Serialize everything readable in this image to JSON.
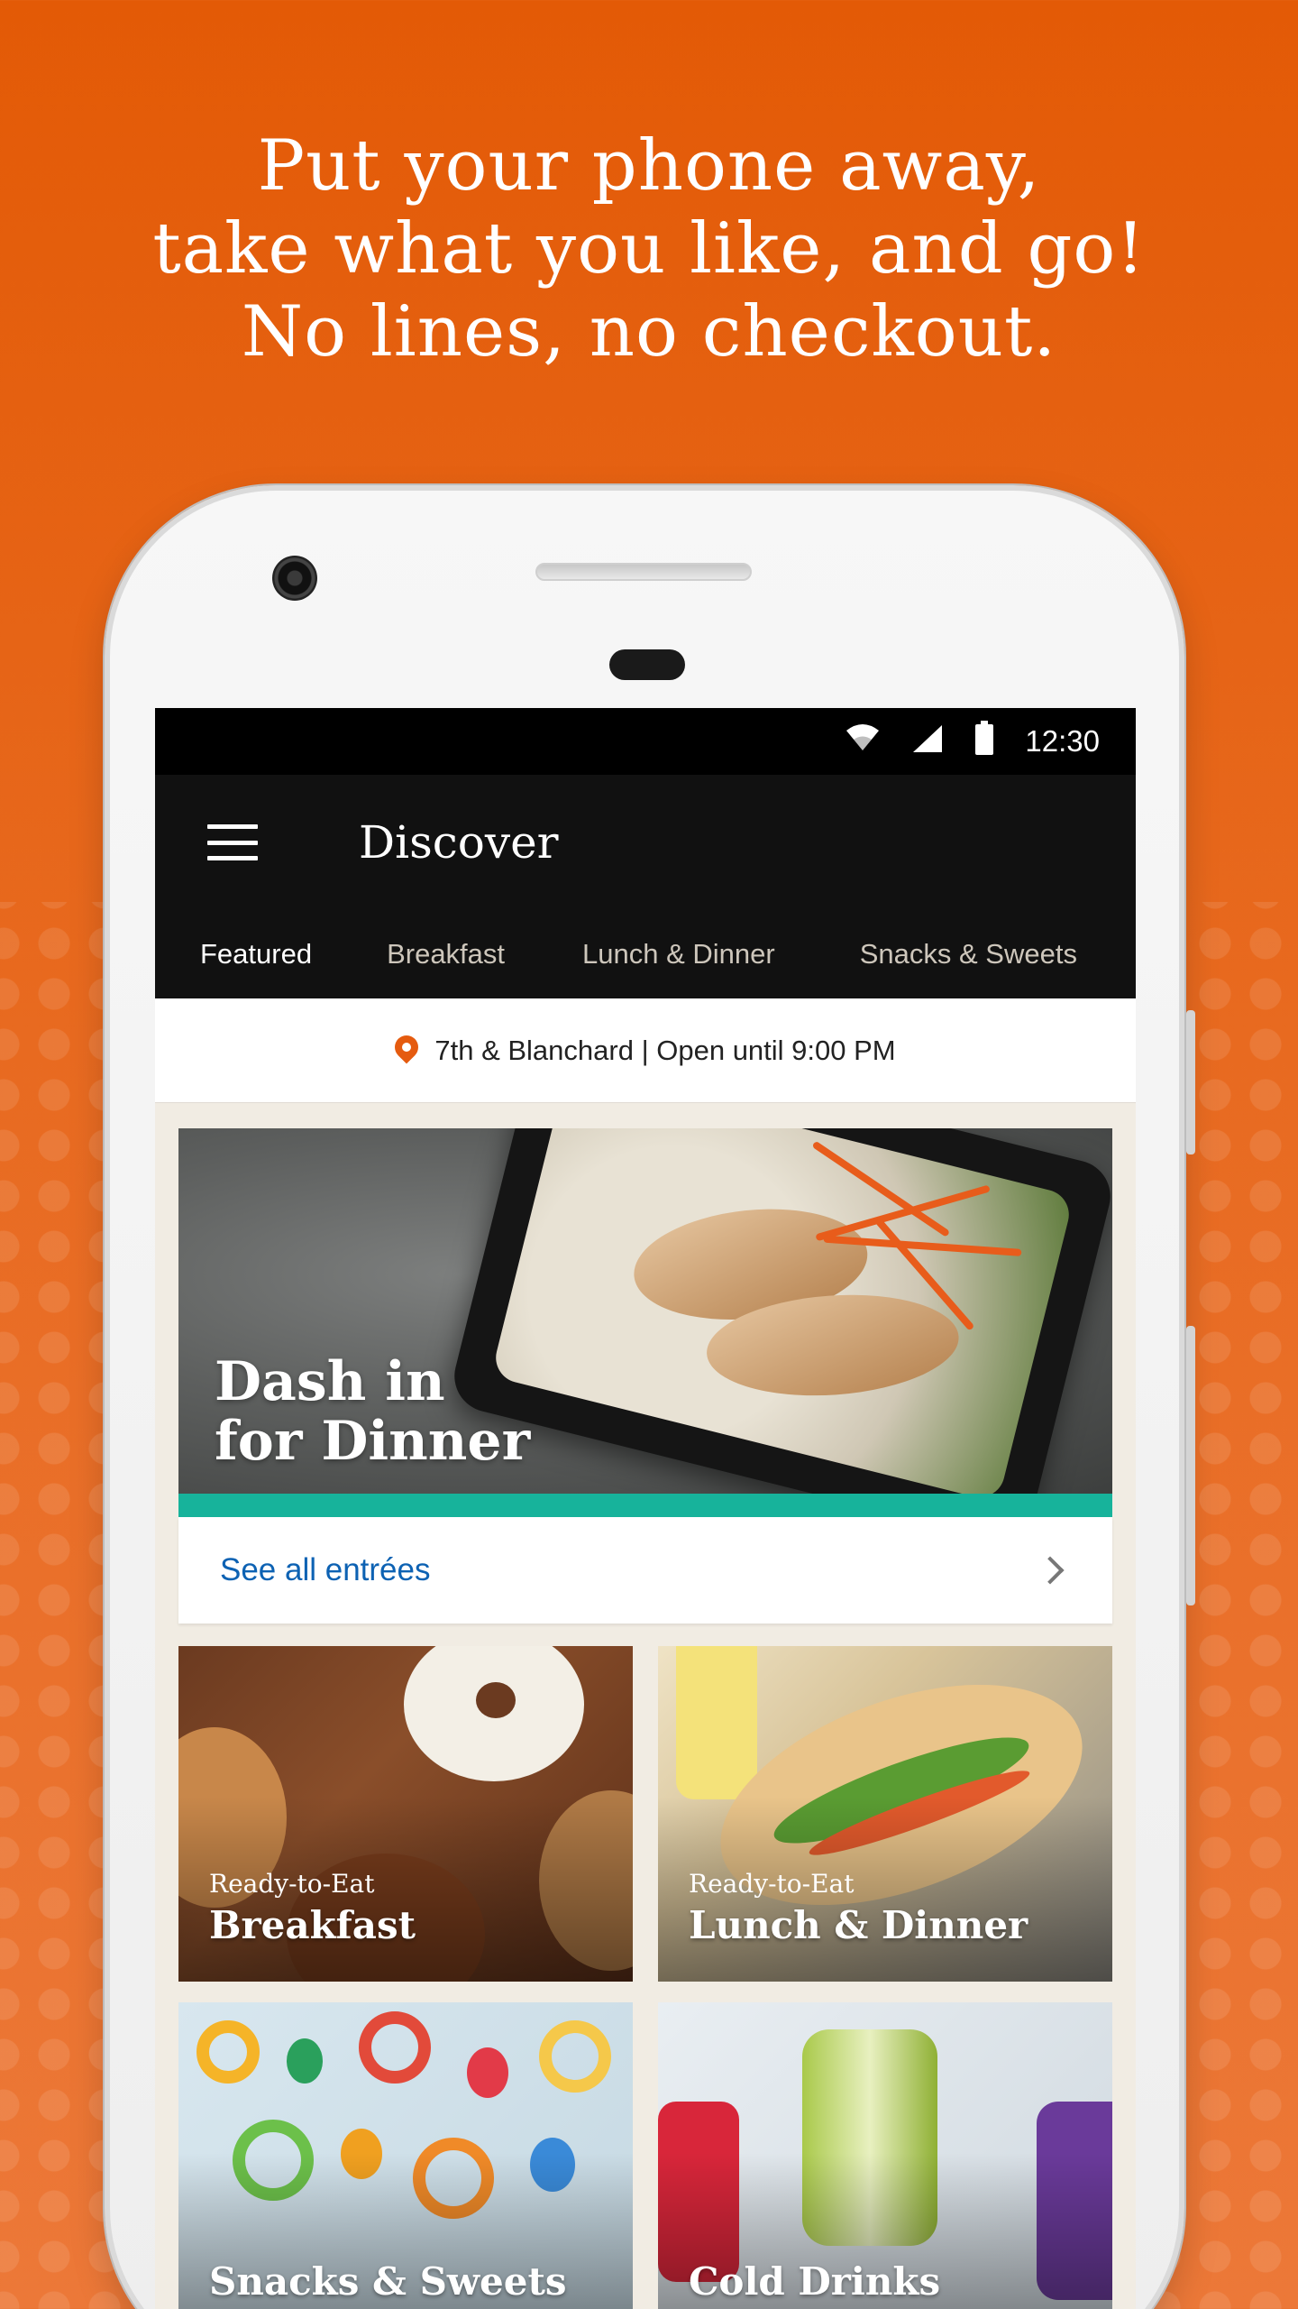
{
  "headline": {
    "line1": "Put your phone away,",
    "line2": "take what you like, and go!",
    "line3": "No lines, no checkout."
  },
  "status_bar": {
    "time": "12:30",
    "icons": [
      "wifi-icon",
      "cell-signal-icon",
      "battery-icon"
    ]
  },
  "app_bar": {
    "title": "Discover",
    "menu_icon": "hamburger-menu-icon"
  },
  "tabs": [
    {
      "label": "Featured",
      "active": true
    },
    {
      "label": "Breakfast",
      "active": false
    },
    {
      "label": "Lunch & Dinner",
      "active": false
    },
    {
      "label": "Snacks & Sweets",
      "active": false
    }
  ],
  "location": {
    "icon": "location-pin-icon",
    "text": "7th & Blanchard | Open until 9:00 PM"
  },
  "feature": {
    "title_line1": "Dash in",
    "title_line2": "for Dinner",
    "link_label": "See all entrées"
  },
  "tiles": [
    {
      "sub": "Ready-to-Eat",
      "name": "Breakfast"
    },
    {
      "sub": "Ready-to-Eat",
      "name": "Lunch & Dinner"
    },
    {
      "sub": "",
      "name": "Snacks & Sweets"
    },
    {
      "sub": "",
      "name": "Cold Drinks"
    }
  ],
  "colors": {
    "background": "#e35a06",
    "accent_teal": "#17b39b",
    "link_blue": "#0d62b3",
    "pin_orange": "#e55b0f",
    "app_bar": "#111111"
  }
}
